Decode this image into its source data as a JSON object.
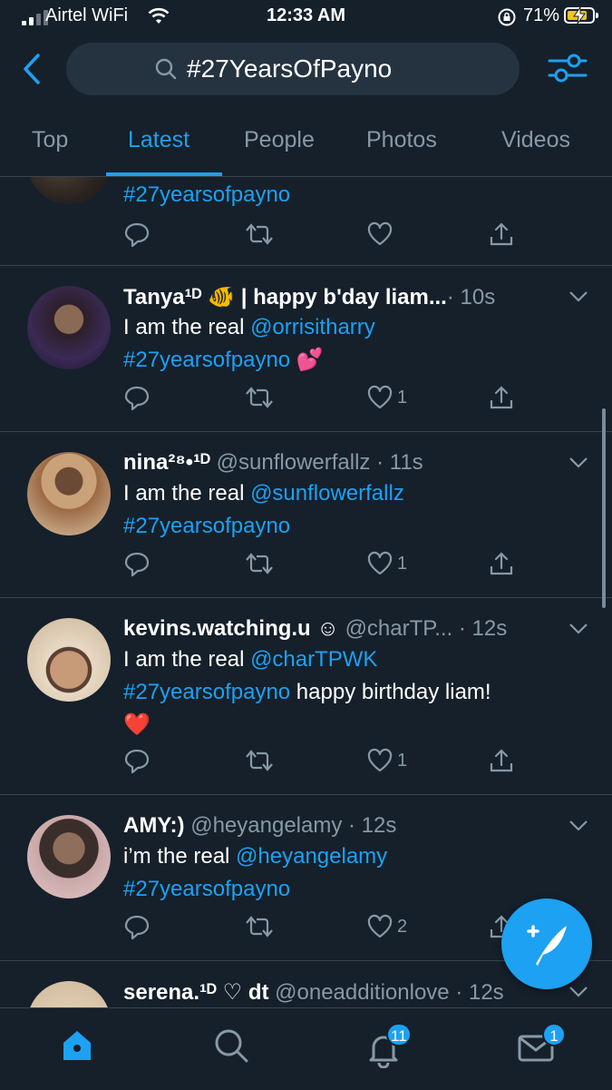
{
  "status_bar": {
    "carrier": "Airtel WiFi",
    "time": "12:33 AM",
    "battery": "71%"
  },
  "search": {
    "query": "#27YearsOfPayno"
  },
  "tabs": [
    {
      "label": "Top"
    },
    {
      "label": "Latest"
    },
    {
      "label": "People"
    },
    {
      "label": "Photos"
    },
    {
      "label": "Videos"
    }
  ],
  "active_tab": "Latest",
  "tweets": [
    {
      "hashtag": "#27yearsofpayno"
    },
    {
      "name": "Tanya¹ᴰ 🐠 | happy b'day liam...",
      "handle": "",
      "time": "· 10s",
      "text_pre": "I am the real ",
      "mention": "@orrisitharry",
      "hashtag": "#27yearsofpayno",
      "text_post": " 💕",
      "likes": "1"
    },
    {
      "name": "nina²⁸•¹ᴰ",
      "handle": "@sunflowerfallz",
      "time": " · 11s",
      "text_pre": "I am the real ",
      "mention": "@sunflowerfallz",
      "hashtag": "#27yearsofpayno",
      "text_post": "",
      "likes": "1"
    },
    {
      "name": "kevins.watching.u ☺",
      "handle": "@charTP...",
      "time": " · 12s",
      "text_pre": "I am the real ",
      "mention": "@charTPWK",
      "hashtag": "#27yearsofpayno",
      "text_post": " happy birthday liam!",
      "extra": "❤️",
      "likes": "1"
    },
    {
      "name": "AMY:)",
      "handle": "@heyangelamy",
      "time": " · 12s",
      "text_pre": "i’m the real ",
      "mention": "@heyangelamy",
      "hashtag": "#27yearsofpayno",
      "text_post": "",
      "likes": "2"
    },
    {
      "name": "serena.¹ᴰ ♡ dt",
      "handle": "@oneadditionlove",
      "time": " · 12s"
    }
  ],
  "nav_badges": {
    "notifications": "11",
    "messages": "1"
  },
  "colors": {
    "background": "#15202b",
    "accent": "#1da1f2",
    "muted": "#8899a6",
    "divider": "#38444d"
  }
}
